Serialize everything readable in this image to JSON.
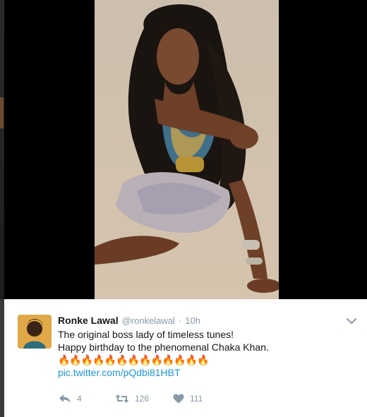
{
  "tweet": {
    "name": "Ronke Lawal",
    "handle": "@ronkelawal",
    "separator": "·",
    "time": "10h",
    "line1": "The original boss lady of timeless tunes!",
    "line2": "Happy birthday to the phenomenal Chaka Khan.",
    "emoji": "🔥🔥🔥🔥🔥🔥🔥🔥🔥🔥🔥🔥🔥",
    "link": "pic.twitter.com/pQdbi81HBT"
  },
  "actions": {
    "reply_count": "4",
    "retweet_count": "126",
    "like_count": "111"
  },
  "icons": {
    "reply": "reply-icon",
    "retweet": "retweet-icon",
    "like": "heart-icon",
    "menu": "chevron-down-icon"
  },
  "colors": {
    "link": "#1b95e0",
    "muted": "#8899a6",
    "name": "#14171a"
  }
}
